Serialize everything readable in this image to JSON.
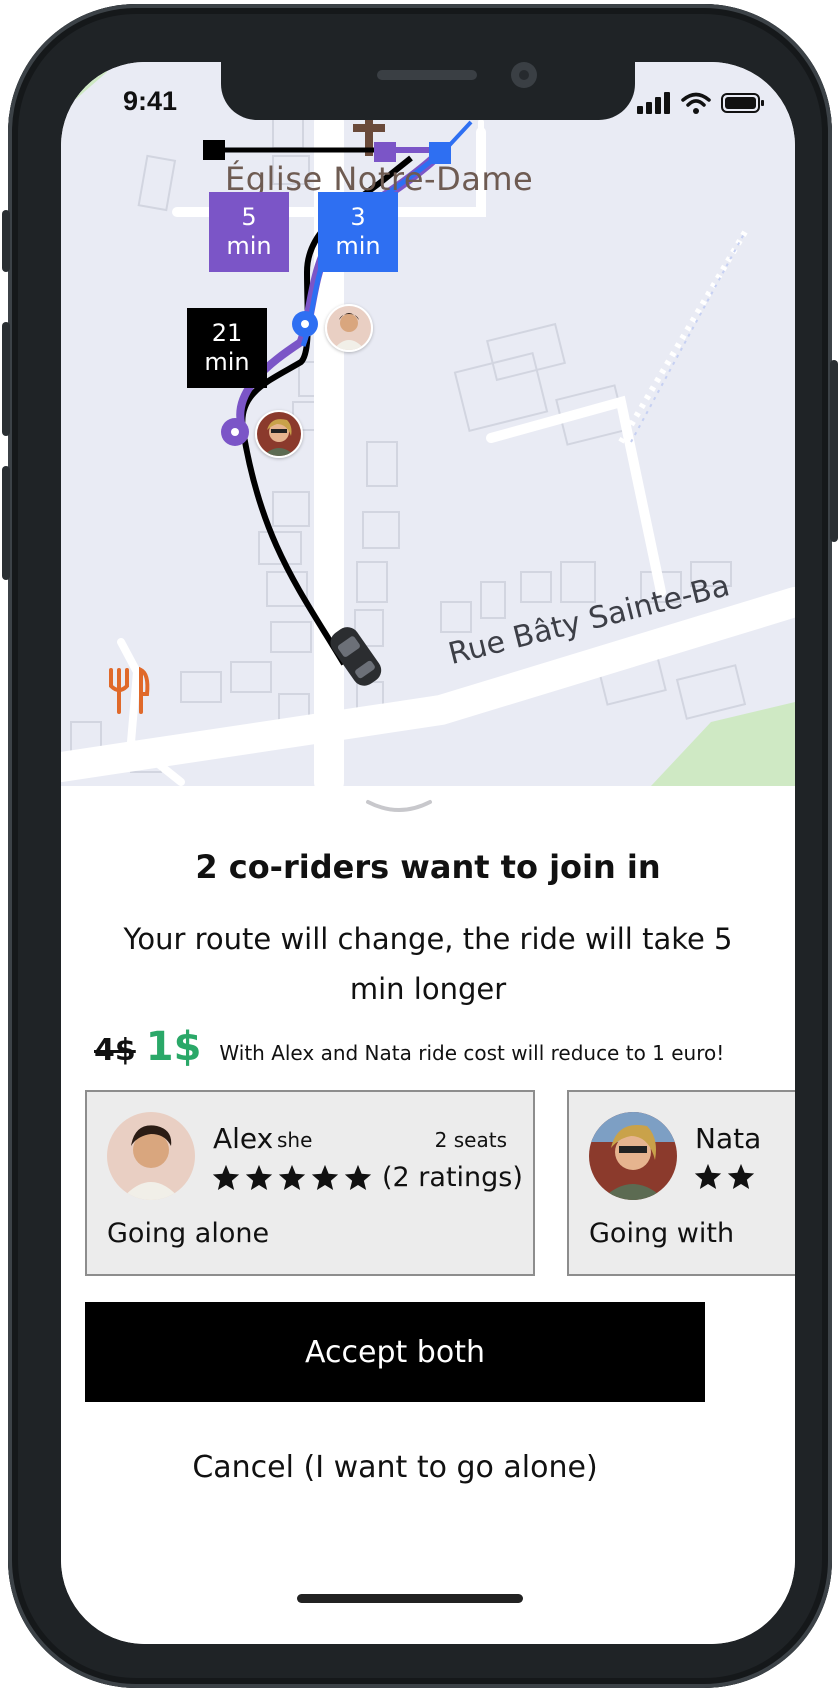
{
  "status_bar": {
    "time": "9:41"
  },
  "map": {
    "church_label": "Église Notre-Dame",
    "street_label": "Rue Bâty Sainte-Ba",
    "badges": [
      {
        "value": "5",
        "unit": "min",
        "color": "#7b55c7"
      },
      {
        "value": "3",
        "unit": "min",
        "color": "#2e6ff2"
      },
      {
        "value": "21",
        "unit": "min",
        "color": "#000000"
      }
    ],
    "colors": {
      "purple_route": "#7b55c7",
      "blue_route": "#2e6ff2",
      "black_route": "#000000",
      "restaurant_icon": "#e0692a",
      "background": "#e9ebf4"
    }
  },
  "sheet": {
    "title": "2 co-riders want to join in",
    "subtitle": "Your route will change, the ride will take 5 min longer",
    "old_price": "4$",
    "new_price": "1$",
    "price_note": "With Alex and Nata ride cost will reduce to 1 euro!",
    "riders": [
      {
        "name": "Alex",
        "pronoun": "she",
        "seats": "2 seats",
        "ratings": "(2 ratings)",
        "stars": 5,
        "status": "Going alone"
      },
      {
        "name": "Nata",
        "status": "Going with"
      }
    ],
    "accept_label": "Accept both",
    "cancel_label": "Cancel (I want to go alone)"
  },
  "colors": {
    "price_green": "#2aa868",
    "card_bg": "#ececec",
    "button_bg": "#000000"
  }
}
